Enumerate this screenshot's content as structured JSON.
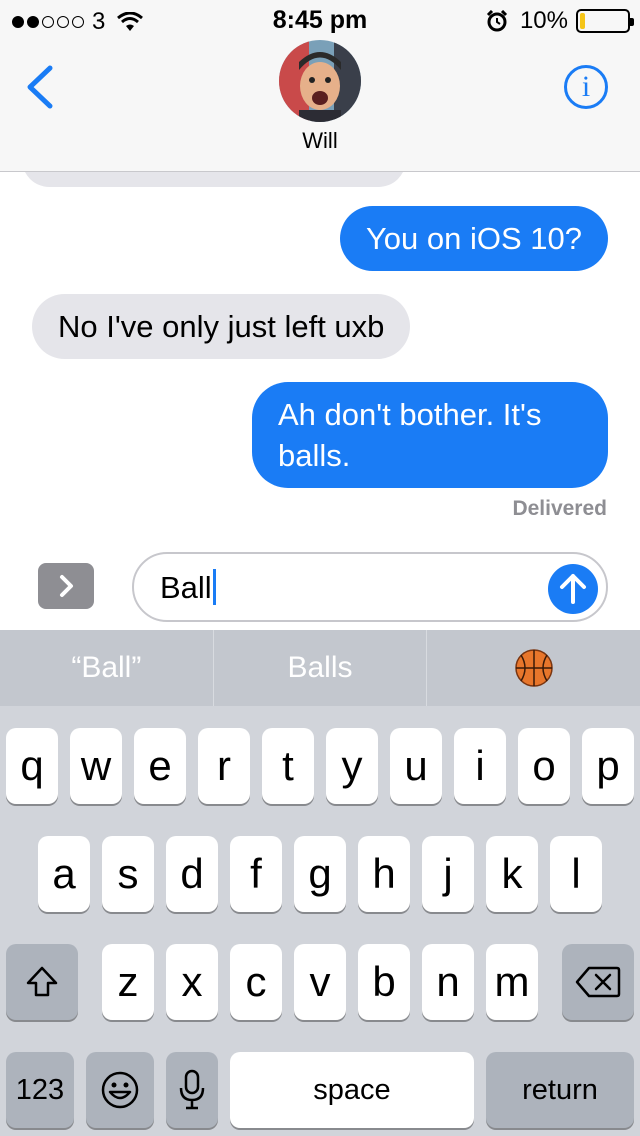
{
  "status_bar": {
    "carrier": "3",
    "time": "8:45 pm",
    "battery": "10%",
    "battery_level": 0.1,
    "signal_bars_filled": 2,
    "signal_bars_total": 5
  },
  "header": {
    "contact_name": "Will",
    "back_icon": "chevron-left-icon",
    "info_label": "i"
  },
  "messages": [
    {
      "direction": "outgoing",
      "text": "You on iOS 10?"
    },
    {
      "direction": "incoming",
      "text": "No I've only just left uxb"
    },
    {
      "direction": "outgoing",
      "text": "Ah don't bother. It's balls."
    }
  ],
  "delivery_status": "Delivered",
  "composer": {
    "value": "Ball"
  },
  "suggestions": [
    "“Ball”",
    "Balls",
    "🏀"
  ],
  "keyboard": {
    "row1": [
      "q",
      "w",
      "e",
      "r",
      "t",
      "y",
      "u",
      "i",
      "o",
      "p"
    ],
    "row2": [
      "a",
      "s",
      "d",
      "f",
      "g",
      "h",
      "j",
      "k",
      "l"
    ],
    "row3": [
      "z",
      "x",
      "c",
      "v",
      "b",
      "n",
      "m"
    ],
    "numbers_label": "123",
    "space_label": "space",
    "return_label": "return"
  },
  "colors": {
    "accent": "#1a7cf5",
    "incoming_bubble": "#e5e5ea",
    "battery_fill": "#f5c518"
  }
}
